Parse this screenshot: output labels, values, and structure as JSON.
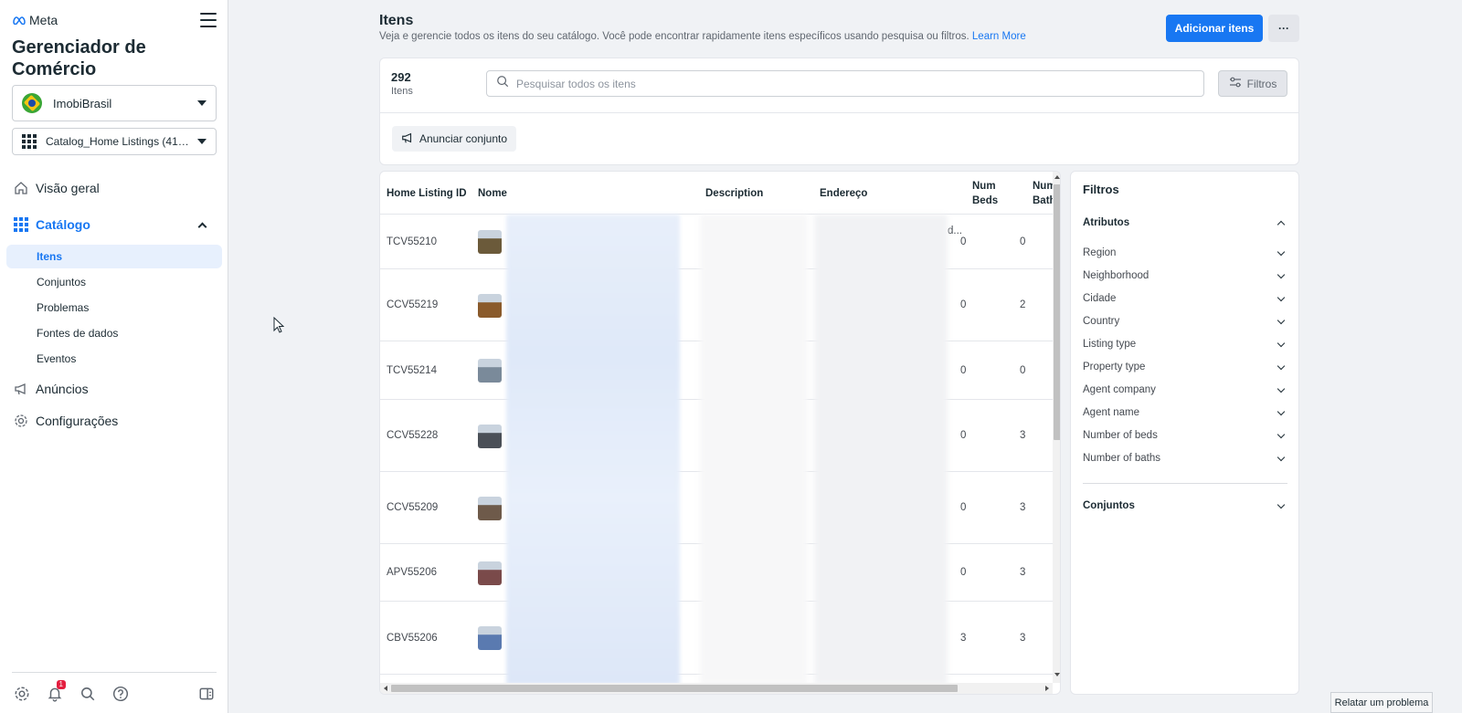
{
  "sidebar": {
    "logo_text": "Meta",
    "app_title": "Gerenciador de Comércio",
    "business_name": "ImobiBrasil",
    "catalog_name": "Catalog_Home Listings (41360...)",
    "nav": {
      "overview": "Visão geral",
      "catalog": "Catálogo",
      "ads": "Anúncios",
      "settings": "Configurações"
    },
    "catalog_sub": [
      "Itens",
      "Conjuntos",
      "Problemas",
      "Fontes de dados",
      "Eventos"
    ],
    "notification_count": "1"
  },
  "header": {
    "title": "Itens",
    "subtitle": "Veja e gerencie todos os itens do seu catálogo. Você pode encontrar rapidamente itens específicos usando pesquisa ou filtros.",
    "learn_more": "Learn More",
    "add_button": "Adicionar itens",
    "more_button": "···"
  },
  "toolbar": {
    "count": "292",
    "count_label": "Itens",
    "search_placeholder": "Pesquisar todos os itens",
    "filter_button": "Filtros",
    "announce_button": "Anunciar conjunto"
  },
  "table": {
    "columns": [
      "Home Listing ID",
      "Nome",
      "Description",
      "Endereço",
      "Num Beds",
      "Num Baths"
    ],
    "rows": [
      {
        "id": "TCV55210",
        "beds": "0",
        "baths": "0",
        "thumb": "#6b5a3a"
      },
      {
        "id": "CCV55219",
        "beds": "0",
        "baths": "2",
        "thumb": "#8a5a2b"
      },
      {
        "id": "TCV55214",
        "beds": "0",
        "baths": "0",
        "thumb": "#7a8a9a"
      },
      {
        "id": "CCV55228",
        "beds": "0",
        "baths": "3",
        "thumb": "#4a4f57"
      },
      {
        "id": "CCV55209",
        "beds": "0",
        "baths": "3",
        "thumb": "#6e5a4a"
      },
      {
        "id": "APV55206",
        "beds": "0",
        "baths": "3",
        "thumb": "#7a4a4a"
      },
      {
        "id": "CBV55206",
        "beds": "3",
        "baths": "3",
        "thumb": "#5a7ab0"
      }
    ],
    "address_overflow": "d..."
  },
  "filters": {
    "title": "Filtros",
    "attributes_label": "Atributos",
    "attributes": [
      "Region",
      "Neighborhood",
      "Cidade",
      "Country",
      "Listing type",
      "Property type",
      "Agent company",
      "Agent name",
      "Number of beds",
      "Number of baths"
    ],
    "sets_label": "Conjuntos"
  },
  "report_button": "Relatar um problema",
  "colors": {
    "accent": "#1877f2",
    "background": "#f0f2f5"
  }
}
